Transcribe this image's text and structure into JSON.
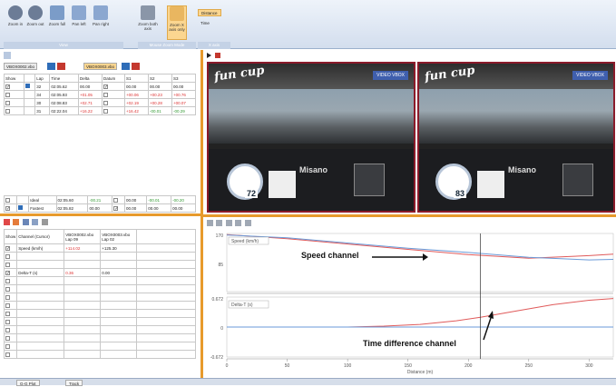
{
  "ribbon": {
    "buttons": [
      {
        "label": "Zoom in",
        "icon": "zoom-in-icon"
      },
      {
        "label": "Zoom out",
        "icon": "zoom-out-icon"
      },
      {
        "label": "Zoom full",
        "icon": "zoom-full-icon"
      },
      {
        "label": "Pan left",
        "icon": "pan-left-icon"
      },
      {
        "label": "Pan right",
        "icon": "pan-right-icon"
      },
      {
        "label": "Zoom both axis",
        "icon": "zoom-both-icon"
      },
      {
        "label": "Zoom X axis only",
        "icon": "zoom-x-icon"
      }
    ],
    "groups": [
      "View",
      "Mouse Zoom Mode",
      "X axis"
    ],
    "xmode": {
      "distance": "Distance",
      "time": "Time"
    }
  },
  "laps": {
    "file_tabs": [
      "VBOX0002.vbo",
      "VBOX0003.vbo"
    ],
    "headers": [
      "Show",
      "",
      "Lap",
      "Time",
      "Delta",
      "Datum",
      "S1",
      "S2",
      "S3"
    ],
    "rows": [
      {
        "lap": "32",
        "time": "02:05.62",
        "delta": "00.00",
        "s1": "00.00",
        "s2": "00.00",
        "s3": "00.00"
      },
      {
        "lap": "34",
        "time": "02:05.93",
        "delta": "+01.05",
        "s1": "+00.06",
        "s2": "+00.23",
        "s3": "+00.76"
      },
      {
        "lap": "30",
        "time": "02:08.83",
        "delta": "+02.71",
        "s1": "+02.19",
        "s2": "+00.28",
        "s3": "+00.07"
      },
      {
        "lap": "31",
        "time": "02:22.04",
        "delta": "+16.22",
        "s1": "+16.42",
        "s2": "-00.01",
        "s3": "-00.29"
      }
    ],
    "footer": [
      {
        "name": "Ideal",
        "time": "02:05.60",
        "delta": "-00.21",
        "s1": "00.00",
        "s2": "-00.01",
        "s3": "-00.20"
      },
      {
        "name": "Fastest",
        "time": "02:05.82",
        "delta": "00.00",
        "s1": "00.00",
        "s2": "00.00",
        "s3": "00.00"
      }
    ]
  },
  "channels": {
    "headers": [
      "Show",
      "Channel (Cursor)",
      "VBOX0002.vbo Lap 09",
      "VBOX0003.vbo Lap 02"
    ],
    "rows": [
      {
        "name": "Speed (km/h)",
        "v1": "+114.02",
        "v2": "+125.30"
      },
      {
        "name": "",
        "v1": "",
        "v2": ""
      },
      {
        "name": "",
        "v1": "",
        "v2": ""
      },
      {
        "name": "Delta-T (s)",
        "v1": "0.36",
        "v2": "0.00"
      }
    ]
  },
  "videos": [
    {
      "logo": "fun cup",
      "badge": "VIDEO VBOX",
      "speed": "72",
      "track": "Misano"
    },
    {
      "logo": "fun cup",
      "badge": "VIDEO VBOX",
      "speed": "83",
      "track": "Misano"
    }
  ],
  "chart_data": {
    "type": "line",
    "xlabel": "Distance (m)",
    "xlim": [
      0,
      320
    ],
    "x_ticks": [
      "0",
      "50",
      "100",
      "150",
      "200",
      "250",
      "300"
    ],
    "top_ticks": [
      "170",
      "85"
    ],
    "bottom_ticks": [
      "0.672",
      "0",
      "-0.672"
    ],
    "cursor_x": 210,
    "plots": [
      {
        "label": "Speed (km/h)",
        "ylim": [
          60,
          170
        ],
        "series": [
          {
            "name": "VBOX0002.vbo",
            "color": "#e05a5a",
            "x": [
              0,
              50,
              100,
              150,
              200,
              250,
              300,
              320
            ],
            "y": [
              168,
              160,
              150,
              140,
              130,
              123,
              128,
              131
            ]
          },
          {
            "name": "VBOX0003.vbo",
            "color": "#6a9ad8",
            "x": [
              0,
              50,
              100,
              150,
              200,
              250,
              300,
              320
            ],
            "y": [
              167,
              162,
              152,
              142,
              134,
              125,
              120,
              121
            ]
          }
        ]
      },
      {
        "label": "Delta-T (s)",
        "ylim": [
          -0.672,
          0.672
        ],
        "series": [
          {
            "name": "VBOX0002.vbo",
            "color": "#e05a5a",
            "x": [
              0,
              50,
              100,
              130,
              160,
              190,
              210,
              240,
              270,
              300,
              320
            ],
            "y": [
              0,
              0,
              0,
              0.02,
              0.06,
              0.14,
              0.22,
              0.36,
              0.5,
              0.6,
              0.64
            ]
          },
          {
            "name": "VBOX0003.vbo",
            "color": "#6a9ad8",
            "x": [
              0,
              320
            ],
            "y": [
              0,
              0
            ]
          }
        ]
      }
    ]
  },
  "annotations": {
    "speed": "Speed channel",
    "time": "Time difference channel"
  },
  "status_tabs": [
    "G-G Plot",
    "Track"
  ],
  "colors": {
    "accent": "#e79a2c",
    "frame": "#8a1a2a"
  }
}
